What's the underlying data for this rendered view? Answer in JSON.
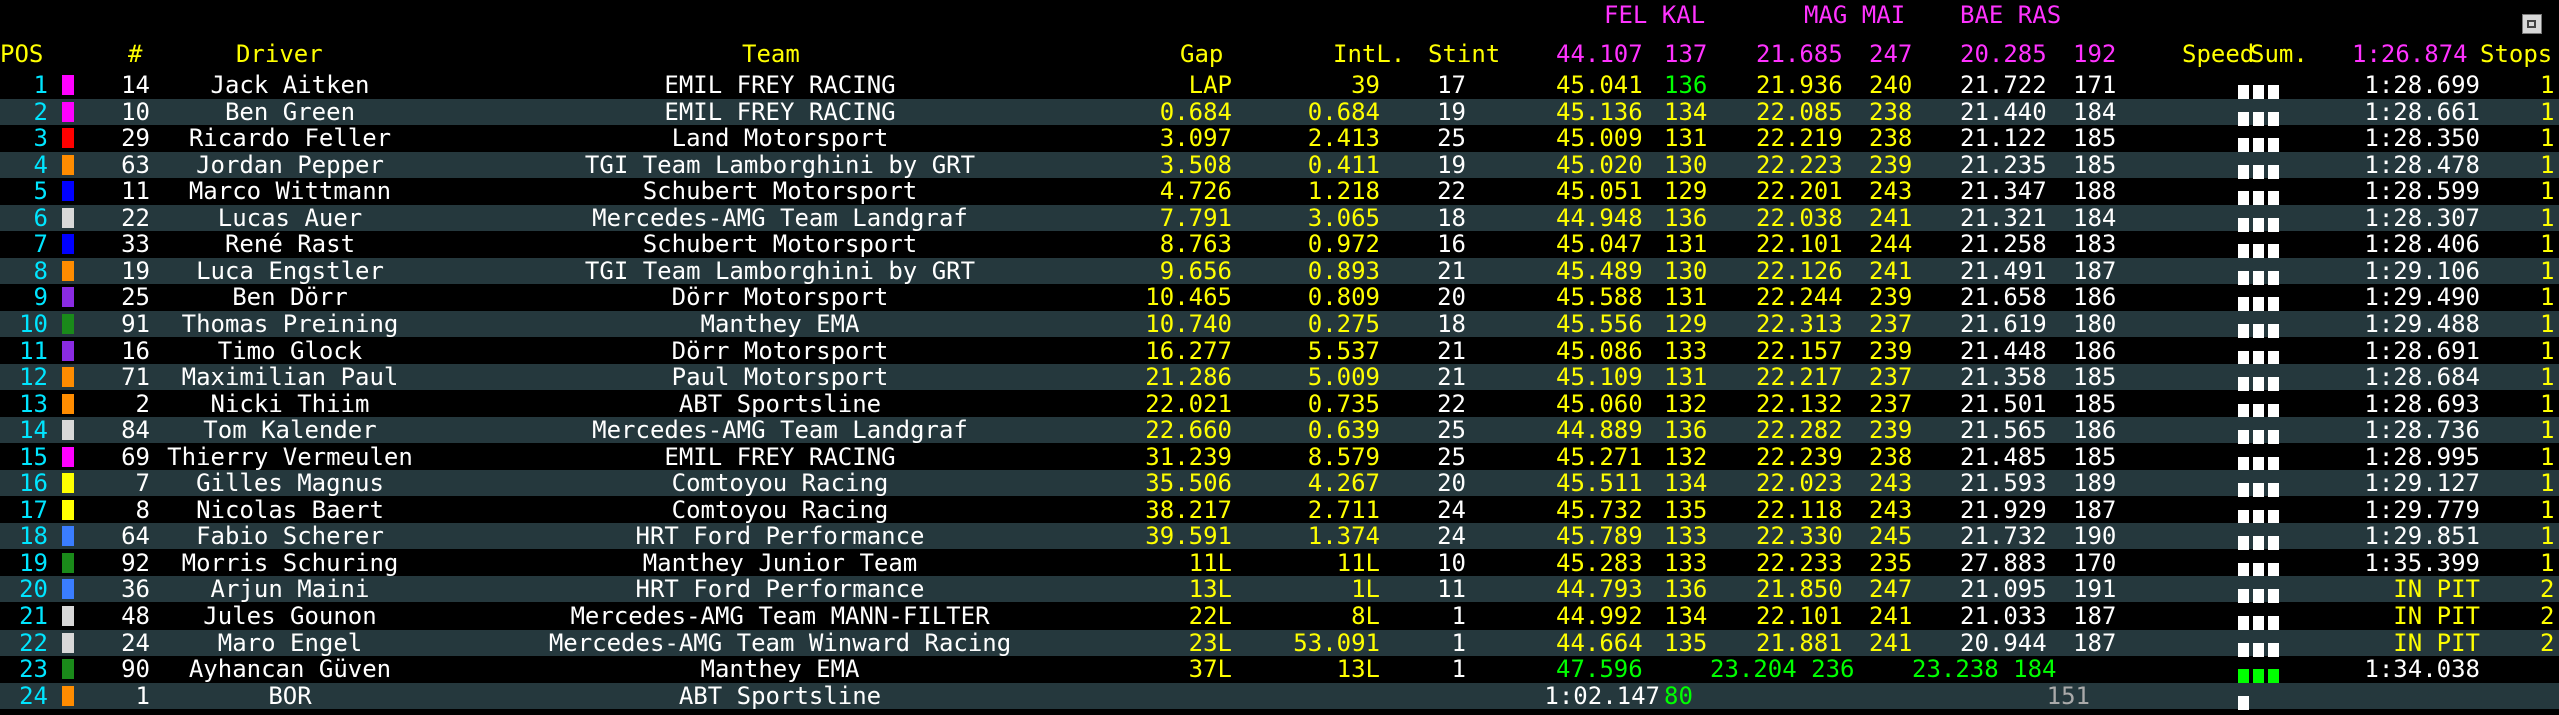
{
  "colors": {
    "header": "#ffff00",
    "pos": "#00e5ff",
    "white": "#ffffff",
    "yellow": "#ffff00",
    "green": "#00ff00",
    "magenta": "#ff33ff",
    "gray": "#aaaaaa",
    "row_alt": "#25383d"
  },
  "best_sectors": {
    "s1_driver": "FEL KAL",
    "s1_time": "44.107",
    "s1_speed": "137",
    "s2_driver": "MAG MAI",
    "s2_time": "21.685",
    "s2_speed": "247",
    "s3_driver": "BAE RAS",
    "s3_time": "20.285",
    "s3_speed": "192",
    "best_lap": "1:26.874"
  },
  "headers": {
    "pos": "POS",
    "num": "#",
    "driver": "Driver",
    "team": "Team",
    "gap": "Gap",
    "int": "IntL.",
    "stint": "Stint",
    "speed": "Speed",
    "sum": "Sum.",
    "stops": "Stops"
  },
  "rows": [
    {
      "pos": "1",
      "sw": "#ff00ff",
      "num": "14",
      "driver": "Jack Aitken",
      "team": "EMIL FREY RACING",
      "gap": "LAP",
      "int": "39",
      "stint": "17",
      "s1": "45.041",
      "sp1": "136",
      "sp1c": "green",
      "s2": "21.936",
      "sp2": "240",
      "s3": "21.722",
      "sp3": "171",
      "sq": "white",
      "last": "1:28.699",
      "stops": "1"
    },
    {
      "pos": "2",
      "sw": "#ff00ff",
      "num": "10",
      "driver": "Ben Green",
      "team": "EMIL FREY RACING",
      "gap": "0.684",
      "int": "0.684",
      "stint": "19",
      "s1": "45.136",
      "sp1": "134",
      "s2": "22.085",
      "sp2": "238",
      "s3": "21.440",
      "sp3": "184",
      "sq": "white",
      "last": "1:28.661",
      "stops": "1"
    },
    {
      "pos": "3",
      "sw": "#ff0000",
      "num": "29",
      "driver": "Ricardo Feller",
      "team": "Land Motorsport",
      "gap": "3.097",
      "int": "2.413",
      "stint": "25",
      "s1": "45.009",
      "sp1": "131",
      "s2": "22.219",
      "sp2": "238",
      "s3": "21.122",
      "sp3": "185",
      "sq": "white",
      "last": "1:28.350",
      "stops": "1"
    },
    {
      "pos": "4",
      "sw": "#ff8c00",
      "num": "63",
      "driver": "Jordan Pepper",
      "team": "TGI Team Lamborghini by GRT",
      "gap": "3.508",
      "int": "0.411",
      "stint": "19",
      "s1": "45.020",
      "sp1": "130",
      "s2": "22.223",
      "sp2": "239",
      "s3": "21.235",
      "sp3": "185",
      "sq": "white",
      "last": "1:28.478",
      "stops": "1"
    },
    {
      "pos": "5",
      "sw": "#0000ff",
      "num": "11",
      "driver": "Marco Wittmann",
      "team": "Schubert Motorsport",
      "gap": "4.726",
      "int": "1.218",
      "stint": "22",
      "s1": "45.051",
      "sp1": "129",
      "s2": "22.201",
      "sp2": "243",
      "s3": "21.347",
      "sp3": "188",
      "sq": "white",
      "last": "1:28.599",
      "stops": "1"
    },
    {
      "pos": "6",
      "sw": "#d8d8d8",
      "num": "22",
      "driver": "Lucas Auer",
      "team": "Mercedes-AMG Team Landgraf",
      "gap": "7.791",
      "int": "3.065",
      "stint": "18",
      "s1": "44.948",
      "sp1": "136",
      "s2": "22.038",
      "sp2": "241",
      "s3": "21.321",
      "sp3": "184",
      "sq": "white",
      "last": "1:28.307",
      "stops": "1"
    },
    {
      "pos": "7",
      "sw": "#0000ff",
      "num": "33",
      "driver": "René Rast",
      "team": "Schubert Motorsport",
      "gap": "8.763",
      "int": "0.972",
      "stint": "16",
      "s1": "45.047",
      "sp1": "131",
      "s2": "22.101",
      "sp2": "244",
      "s3": "21.258",
      "sp3": "183",
      "sq": "white",
      "last": "1:28.406",
      "stops": "1"
    },
    {
      "pos": "8",
      "sw": "#ff8c00",
      "num": "19",
      "driver": "Luca Engstler",
      "team": "TGI Team Lamborghini by GRT",
      "gap": "9.656",
      "int": "0.893",
      "stint": "21",
      "s1": "45.489",
      "sp1": "130",
      "s2": "22.126",
      "sp2": "241",
      "s3": "21.491",
      "sp3": "187",
      "sq": "white",
      "last": "1:29.106",
      "stops": "1"
    },
    {
      "pos": "9",
      "sw": "#8a2be2",
      "num": "25",
      "driver": "Ben Dörr",
      "team": "Dörr Motorsport",
      "gap": "10.465",
      "int": "0.809",
      "stint": "20",
      "s1": "45.588",
      "sp1": "131",
      "s2": "22.244",
      "sp2": "239",
      "s3": "21.658",
      "sp3": "186",
      "sq": "white",
      "last": "1:29.490",
      "stops": "1"
    },
    {
      "pos": "10",
      "sw": "#1a8a1a",
      "num": "91",
      "driver": "Thomas Preining",
      "team": "Manthey EMA",
      "gap": "10.740",
      "int": "0.275",
      "stint": "18",
      "s1": "45.556",
      "sp1": "129",
      "s2": "22.313",
      "sp2": "237",
      "s3": "21.619",
      "sp3": "180",
      "sq": "white",
      "last": "1:29.488",
      "stops": "1"
    },
    {
      "pos": "11",
      "sw": "#8a2be2",
      "num": "16",
      "driver": "Timo Glock",
      "team": "Dörr Motorsport",
      "gap": "16.277",
      "int": "5.537",
      "stint": "21",
      "s1": "45.086",
      "sp1": "133",
      "s2": "22.157",
      "sp2": "239",
      "s3": "21.448",
      "sp3": "186",
      "sq": "white",
      "last": "1:28.691",
      "stops": "1"
    },
    {
      "pos": "12",
      "sw": "#ff8c00",
      "num": "71",
      "driver": "Maximilian Paul",
      "team": "Paul Motorsport",
      "gap": "21.286",
      "int": "5.009",
      "stint": "21",
      "s1": "45.109",
      "sp1": "131",
      "s2": "22.217",
      "sp2": "237",
      "s3": "21.358",
      "sp3": "185",
      "sq": "white",
      "last": "1:28.684",
      "stops": "1"
    },
    {
      "pos": "13",
      "sw": "#ff8c00",
      "num": "2",
      "driver": "Nicki Thiim",
      "team": "ABT Sportsline",
      "gap": "22.021",
      "int": "0.735",
      "stint": "22",
      "s1": "45.060",
      "sp1": "132",
      "s2": "22.132",
      "sp2": "237",
      "s3": "21.501",
      "sp3": "185",
      "sq": "white",
      "last": "1:28.693",
      "stops": "1"
    },
    {
      "pos": "14",
      "sw": "#d8d8d8",
      "num": "84",
      "driver": "Tom Kalender",
      "team": "Mercedes-AMG Team Landgraf",
      "gap": "22.660",
      "int": "0.639",
      "stint": "25",
      "s1": "44.889",
      "sp1": "136",
      "s2": "22.282",
      "sp2": "239",
      "s3": "21.565",
      "sp3": "186",
      "sq": "white",
      "last": "1:28.736",
      "stops": "1"
    },
    {
      "pos": "15",
      "sw": "#ff00ff",
      "num": "69",
      "driver": "Thierry Vermeulen",
      "team": "EMIL FREY RACING",
      "gap": "31.239",
      "int": "8.579",
      "stint": "25",
      "s1": "45.271",
      "sp1": "132",
      "s2": "22.239",
      "sp2": "238",
      "s3": "21.485",
      "sp3": "185",
      "sq": "white",
      "last": "1:28.995",
      "stops": "1"
    },
    {
      "pos": "16",
      "sw": "#ffff00",
      "num": "7",
      "driver": "Gilles Magnus",
      "team": "Comtoyou Racing",
      "gap": "35.506",
      "int": "4.267",
      "stint": "20",
      "s1": "45.511",
      "sp1": "134",
      "s2": "22.023",
      "sp2": "243",
      "s3": "21.593",
      "sp3": "189",
      "sq": "white",
      "last": "1:29.127",
      "stops": "1"
    },
    {
      "pos": "17",
      "sw": "#ffff00",
      "num": "8",
      "driver": "Nicolas Baert",
      "team": "Comtoyou Racing",
      "gap": "38.217",
      "int": "2.711",
      "stint": "24",
      "s1": "45.732",
      "sp1": "135",
      "s2": "22.118",
      "sp2": "243",
      "s3": "21.929",
      "sp3": "187",
      "sq": "white",
      "last": "1:29.779",
      "stops": "1"
    },
    {
      "pos": "18",
      "sw": "#3a7dff",
      "num": "64",
      "driver": "Fabio Scherer",
      "team": "HRT Ford Performance",
      "gap": "39.591",
      "int": "1.374",
      "stint": "24",
      "s1": "45.789",
      "sp1": "133",
      "s2": "22.330",
      "sp2": "245",
      "s3": "21.732",
      "sp3": "190",
      "sq": "white",
      "last": "1:29.851",
      "stops": "1"
    },
    {
      "pos": "19",
      "sw": "#1a8a1a",
      "num": "92",
      "driver": "Morris Schuring",
      "team": "Manthey Junior Team",
      "gap": "11L",
      "int": "11L",
      "stint": "10",
      "s1": "45.283",
      "sp1": "133",
      "s2": "22.233",
      "sp2": "235",
      "s3": "27.883",
      "sp3": "170",
      "sq": "white",
      "last": "1:35.399",
      "stops": "1"
    },
    {
      "pos": "20",
      "sw": "#3a7dff",
      "num": "36",
      "driver": "Arjun Maini",
      "team": "HRT Ford Performance",
      "gap": "13L",
      "int": "1L",
      "stint": "11",
      "s1": "44.793",
      "sp1": "136",
      "s2": "21.850",
      "sp2": "247",
      "s3": "21.095",
      "sp3": "191",
      "sq": "white",
      "last": "IN PIT",
      "lastc": "yellow",
      "stops": "2"
    },
    {
      "pos": "21",
      "sw": "#d8d8d8",
      "num": "48",
      "driver": "Jules Gounon",
      "team": "Mercedes-AMG Team MANN-FILTER",
      "gap": "22L",
      "int": "8L",
      "stint": "1",
      "s1": "44.992",
      "sp1": "134",
      "s2": "22.101",
      "sp2": "241",
      "s3": "21.033",
      "sp3": "187",
      "sq": "white",
      "last": "IN PIT",
      "lastc": "yellow",
      "stops": "2"
    },
    {
      "pos": "22",
      "sw": "#d8d8d8",
      "num": "24",
      "driver": "Maro Engel",
      "team": "Mercedes-AMG Team Winward Racing",
      "gap": "23L",
      "int": "53.091",
      "stint": "1",
      "s1": "44.664",
      "sp1": "135",
      "s2": "21.881",
      "sp2": "241",
      "s3": "20.944",
      "sp3": "187",
      "sq": "white",
      "last": "IN PIT",
      "lastc": "yellow",
      "stops": "2"
    },
    {
      "pos": "23",
      "sw": "#1a8a1a",
      "num": "90",
      "driver": "Ayhancan Güven",
      "team": "Manthey EMA",
      "gap": "37L",
      "int": "13L",
      "stint": "1",
      "s1": "47.596",
      "s1c": "green",
      "s1shift": true,
      "sp1": "",
      "s2": "23.204 236",
      "s2c": "green",
      "s2shift": true,
      "sp2": "",
      "s3": "23.238 184",
      "s3c": "green",
      "s3shift": true,
      "sp3": "",
      "sq": "green",
      "last": "1:34.038",
      "stops": ""
    },
    {
      "pos": "24",
      "sw": "#ff8c00",
      "num": "1",
      "driver": "BOR",
      "team": "ABT Sportsline",
      "gap": "",
      "int": "",
      "stint": "",
      "s1": "1:02.147",
      "s1c": "white",
      "s1wide": true,
      "sp1": "80",
      "sp1c": "green",
      "s2": "",
      "sp2": "",
      "s3": "151",
      "s3c": "gray",
      "s3only": true,
      "sp3": "",
      "sq": "single",
      "last": "",
      "stops": ""
    }
  ]
}
